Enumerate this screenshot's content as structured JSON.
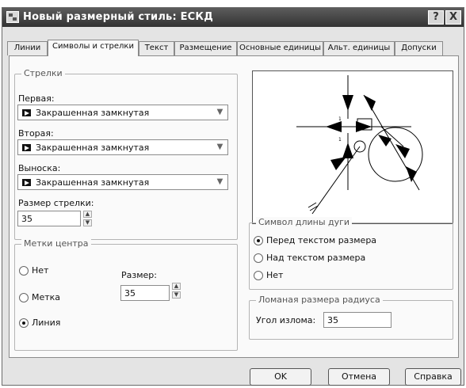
{
  "window": {
    "title": "Новый размерный стиль: ЕСКД",
    "help_button": "?",
    "close_button": "X"
  },
  "tabs": [
    {
      "label": "Линии",
      "active": false
    },
    {
      "label": "Символы и стрелки",
      "active": true
    },
    {
      "label": "Текст",
      "active": false
    },
    {
      "label": "Размещение",
      "active": false
    },
    {
      "label": "Основные единицы",
      "active": false
    },
    {
      "label": "Альт. единицы",
      "active": false
    },
    {
      "label": "Допуски",
      "active": false
    }
  ],
  "arrows": {
    "group_title": "Стрелки",
    "first_label": "Первая:",
    "first_value": "Закрашенная замкнутая",
    "second_label": "Вторая:",
    "second_value": "Закрашенная замкнутая",
    "leader_label": "Выноска:",
    "leader_value": "Закрашенная замкнутая",
    "size_label": "Размер стрелки:",
    "size_value": "35"
  },
  "center_marks": {
    "group_title": "Метки центра",
    "options": [
      {
        "label": "Нет",
        "selected": false
      },
      {
        "label": "Метка",
        "selected": false
      },
      {
        "label": "Линия",
        "selected": true
      }
    ],
    "size_label": "Размер:",
    "size_value": "35"
  },
  "arc_length": {
    "group_title": "Символ длины дуги",
    "options": [
      {
        "label": "Перед текстом размера",
        "selected": true
      },
      {
        "label": "Над текстом размера",
        "selected": false
      },
      {
        "label": "Нет",
        "selected": false
      }
    ]
  },
  "jog": {
    "group_title": "Ломаная размера радиуса",
    "angle_label": "Угол излома:",
    "angle_value": "35"
  },
  "buttons": {
    "ok": "OK",
    "cancel": "Отмена",
    "help": "Справка"
  },
  "colors": {
    "titlebar": "#444444",
    "dialog_bg": "#e4e4e4",
    "panel_bg": "#fafafa"
  }
}
